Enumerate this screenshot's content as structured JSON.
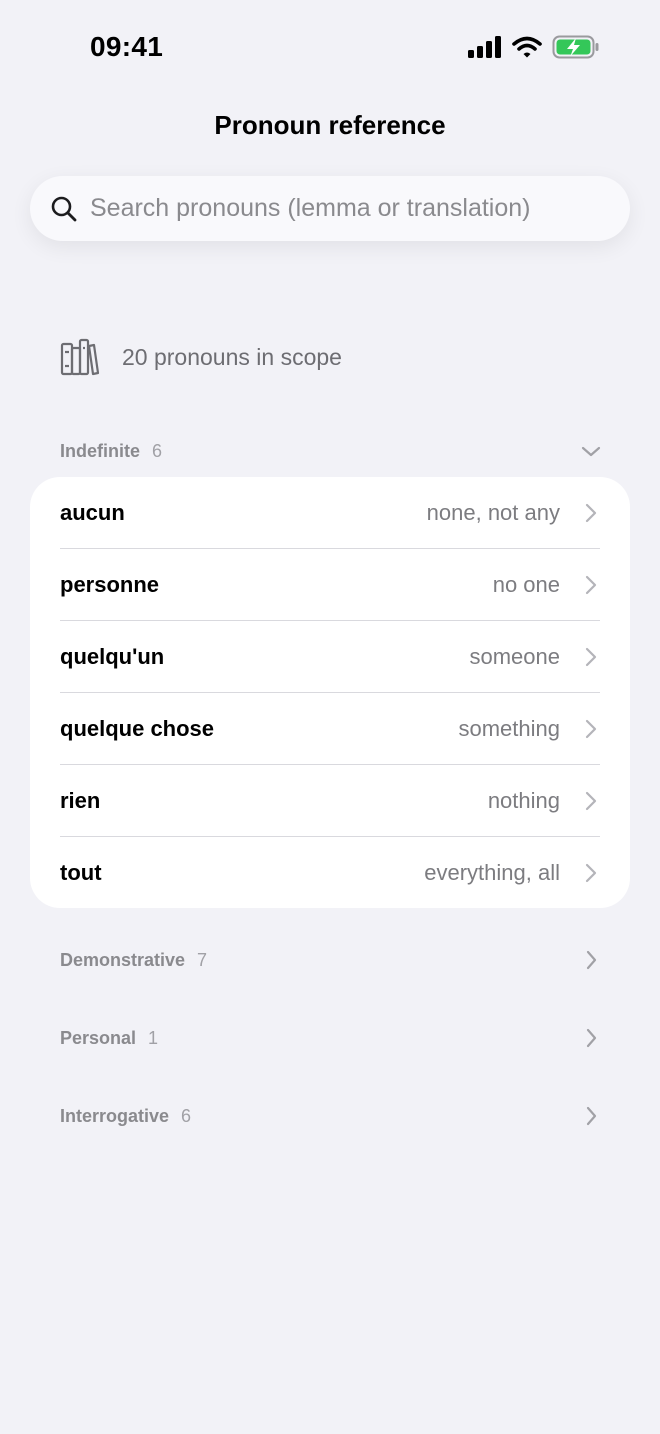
{
  "status_bar": {
    "time": "09:41",
    "icons": [
      "signal-icon",
      "wifi-icon",
      "battery-charging-icon"
    ],
    "battery_color": "#34c759"
  },
  "nav": {
    "title": "Pronoun reference"
  },
  "search": {
    "placeholder": "Search pronouns (lemma or translation)",
    "value": ""
  },
  "scope": {
    "icon": "books-icon",
    "text": "20 pronouns in scope"
  },
  "sections": [
    {
      "title": "Indefinite",
      "count": "6",
      "expanded": true,
      "items": [
        {
          "lemma": "aucun",
          "translation": "none, not any"
        },
        {
          "lemma": "personne",
          "translation": "no one"
        },
        {
          "lemma": "quelqu'un",
          "translation": "someone"
        },
        {
          "lemma": "quelque chose",
          "translation": "something"
        },
        {
          "lemma": "rien",
          "translation": "nothing"
        },
        {
          "lemma": "tout",
          "translation": "everything, all"
        }
      ]
    },
    {
      "title": "Demonstrative",
      "count": "7",
      "expanded": false
    },
    {
      "title": "Personal",
      "count": "1",
      "expanded": false
    },
    {
      "title": "Interrogative",
      "count": "6",
      "expanded": false
    }
  ]
}
